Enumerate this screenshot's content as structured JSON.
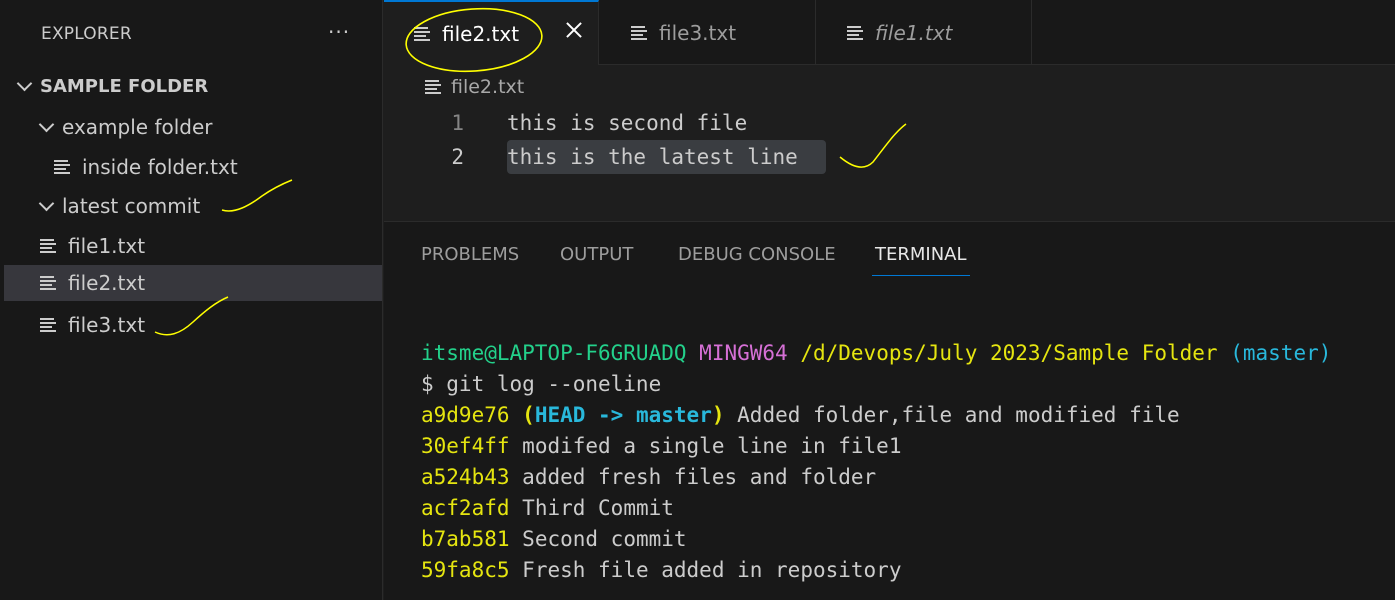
{
  "sidebar": {
    "title": "EXPLORER",
    "more_label": "···",
    "root": "SAMPLE FOLDER",
    "items": [
      {
        "label": "example folder"
      },
      {
        "label": "inside folder.txt"
      },
      {
        "label": "latest commit"
      },
      {
        "label": "file1.txt"
      },
      {
        "label": "file2.txt"
      },
      {
        "label": "file3.txt"
      }
    ]
  },
  "tabs": [
    {
      "label": "file2.txt"
    },
    {
      "label": "file3.txt"
    },
    {
      "label": "file1.txt"
    }
  ],
  "breadcrumb": "file2.txt",
  "editor": {
    "lines": [
      {
        "num": "1",
        "text": "this is second file"
      },
      {
        "num": "2",
        "text": "this is the latest line"
      }
    ]
  },
  "panel": {
    "tabs": [
      "PROBLEMS",
      "OUTPUT",
      "DEBUG CONSOLE",
      "TERMINAL"
    ]
  },
  "terminal": {
    "prompt": {
      "user_host": "itsme@LAPTOP-F6GRUADQ",
      "shell": "MINGW64",
      "path": "/d/Devops/July 2023/Sample Folder",
      "branch": "(master)"
    },
    "command": "$ git log --oneline",
    "commits": [
      {
        "hash": "a9d9e76",
        "ref_open": "(",
        "ref_head": "HEAD -> master",
        "ref_close": ")",
        "message": "Added folder,file and modified file"
      },
      {
        "hash": "30ef4ff",
        "message": "modifed a single line in file1"
      },
      {
        "hash": "a524b43",
        "message": "added fresh files and folder"
      },
      {
        "hash": "acf2afd",
        "message": "Third Commit"
      },
      {
        "hash": "b7ab581",
        "message": "Second commit"
      },
      {
        "hash": "59fa8c5",
        "message": "Fresh file added in repository"
      }
    ]
  },
  "colors": {
    "accent": "#0078d4",
    "annotation": "#ffff00",
    "terminal_green": "#23d18b",
    "terminal_magenta": "#d670d6",
    "terminal_yellow": "#e5e510",
    "terminal_cyan": "#29b8db"
  }
}
